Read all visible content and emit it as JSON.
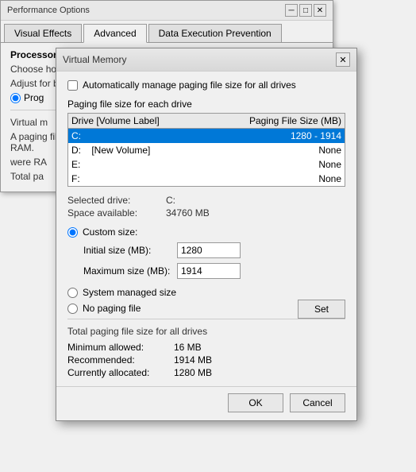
{
  "perf_window": {
    "title": "Performance Options",
    "close_label": "✕",
    "tabs": [
      {
        "label": "Visual Effects",
        "active": false
      },
      {
        "label": "Advanced",
        "active": true
      },
      {
        "label": "Data Execution Prevention",
        "active": false
      }
    ],
    "content": {
      "proc_scheduling_title": "Processor scheduling",
      "proc_scheduling_desc": "Choose how to allocate processor resources.",
      "adjust_label": "Adjust for best performance of:",
      "prog_radio_label": "Prog",
      "vm_title": "Virtual m",
      "vm_desc1": "A paging file is an area on the hard disk that Windows uses as if it were RAM.",
      "vm_desc2": "were RA",
      "total_paging_label": "Total pa"
    }
  },
  "vm_dialog": {
    "title": "Virtual Memory",
    "close_label": "✕",
    "auto_manage_label": "Automatically manage paging file size for all drives",
    "auto_manage_checked": false,
    "paging_section_label": "Paging file size for each drive",
    "drive_table": {
      "col_drive": "Drive  [Volume Label]",
      "col_paging": "Paging File Size (MB)",
      "rows": [
        {
          "drive": "C:",
          "label": "",
          "paging": "1280 - 1914",
          "selected": true
        },
        {
          "drive": "D:",
          "label": "    [New Volume]",
          "paging": "None",
          "selected": false
        },
        {
          "drive": "E:",
          "label": "",
          "paging": "None",
          "selected": false
        },
        {
          "drive": "F:",
          "label": "",
          "paging": "None",
          "selected": false
        }
      ]
    },
    "selected_drive_label": "Selected drive:",
    "selected_drive_value": "C:",
    "space_available_label": "Space available:",
    "space_available_value": "34760 MB",
    "custom_size_label": "Custom size:",
    "initial_size_label": "Initial size (MB):",
    "initial_size_value": "1280",
    "max_size_label": "Maximum size (MB):",
    "max_size_value": "1914",
    "sys_managed_label": "System managed size",
    "no_paging_label": "No paging file",
    "set_btn_label": "Set",
    "total_section_label": "Total paging file size for all drives",
    "min_allowed_label": "Minimum allowed:",
    "min_allowed_value": "16 MB",
    "recommended_label": "Recommended:",
    "recommended_value": "1914 MB",
    "currently_allocated_label": "Currently allocated:",
    "currently_allocated_value": "1280 MB",
    "ok_label": "OK",
    "cancel_label": "Cancel"
  }
}
